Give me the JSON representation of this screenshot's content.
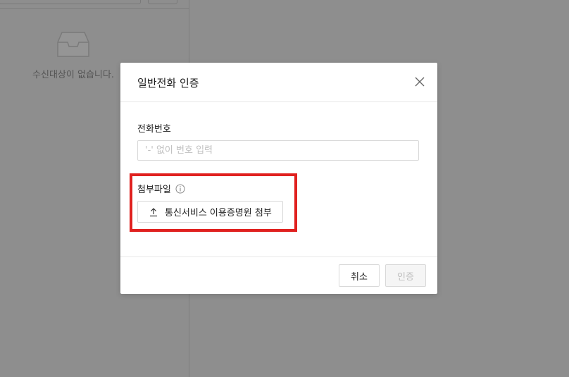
{
  "background": {
    "empty_text": "수신대상이 없습니다."
  },
  "modal": {
    "title": "일반전화 인증",
    "phone": {
      "label": "전화번호",
      "placeholder": "'-' 없이 번호 입력",
      "value": ""
    },
    "attachment": {
      "label": "첨부파일",
      "upload_label": "통신서비스 이용증명원 첨부"
    },
    "footer": {
      "cancel_label": "취소",
      "confirm_label": "인증"
    }
  },
  "colors": {
    "overlay": "#8e8e8e",
    "highlight": "#e0211f",
    "disabled_text": "#bfbfbf"
  }
}
